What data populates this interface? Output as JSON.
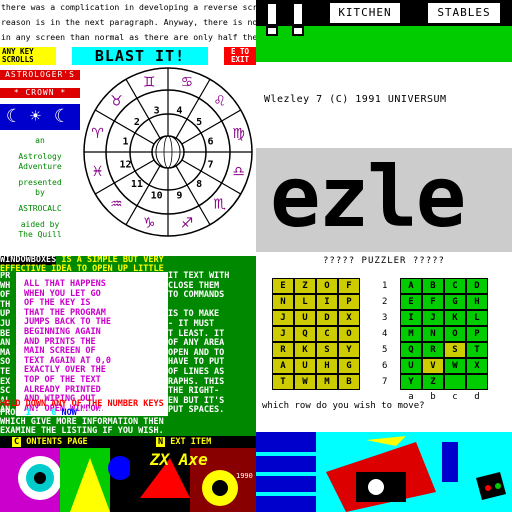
{
  "tl": {
    "scroll_lines": [
      "there was a complication  in  developing  a  reverse  scroll.The",
      "reason is in the next paragraph. Anyway, there is no  more  text",
      "in any screen than normal as there are only  half  the  vertical"
    ],
    "any_key": [
      "ANY KEY",
      "SCROLLS"
    ],
    "blast": "BLAST IT!",
    "exit": [
      "E TO",
      "EXIT"
    ],
    "astrologers": "ASTROLOGER'S",
    "crown": "* CROWN *",
    "moon_icons": [
      "☾",
      "☀",
      "☾"
    ],
    "side_lines": [
      "an",
      "Astrology",
      "Adventure",
      "presented",
      "by",
      "ASTROCALC",
      "aided  by",
      "The Quill"
    ],
    "wheel_numbers": [
      "1",
      "2",
      "3",
      "4",
      "5",
      "6",
      "7",
      "8",
      "9",
      "10",
      "11",
      "12"
    ],
    "wheel_signs": [
      "♈",
      "♉",
      "♊",
      "♋",
      "♌",
      "♍",
      "♎",
      "♏",
      "♐",
      "♑",
      "♒",
      "♓"
    ],
    "colors": {
      "wheel_line": "#000000",
      "sign_color": "#880088"
    }
  },
  "tr": {
    "kitchen": "KITCHEN",
    "stables": "STABLES",
    "title_line": "Wlezley 7    (C)  1991  UNIVERSUM",
    "logo": "ezle"
  },
  "bl": {
    "lines": [
      {
        "segs": [
          {
            "t": "WINDOWBOXES",
            "c": "hl-blk"
          },
          {
            "t": " IS A SIMPLE BUT VERY"
          }
        ]
      },
      {
        "segs": [
          {
            "t": "EFFECTIVE IDEA TO OPEN UP LITTLE"
          }
        ]
      }
    ],
    "popup_lines": [
      "ALL THAT HAPPENS",
      "WHEN YOU LET GO",
      "OF THE KEY IS",
      "THAT THE PROGRAM",
      "JUMPS BACK TO THE",
      "BEGINNING AGAIN",
      "AND PRINTS THE",
      "MAIN SCREEN OF",
      "TEXT AGAIN AT 0,0",
      "EXACTLY OVER THE",
      "TOP OF THE TEXT",
      "ALREADY PRINTED",
      "AND WIPING OUT",
      "ANY OPEN WINDOW."
    ],
    "under_lines": [
      "IT TEXT WITH",
      " CLOSE THEM",
      "TO COMMANDS",
      "",
      " IS TO MAKE",
      " - IT MUST",
      "T LEAST. IT",
      " OF ANY AREA",
      " OPEN AND TO",
      "HAVE TO PUT",
      " OF LINES AS",
      "RAPHS. THIS",
      "  THE RIGHT-",
      "EN BUT IT'S",
      "PUT SPACES."
    ],
    "left_lines": [
      "PR",
      "WH",
      "OF",
      "TH",
      "UP",
      "JU",
      "BE",
      "AN",
      "MA",
      "SO",
      "TE",
      "EX",
      "SC",
      "AL",
      "AN"
    ],
    "hold_line": [
      {
        "t": "HOLD DOWN ANY OF THE NUMBER KEYS",
        "c": "hl-red"
      }
    ],
    "from_line": [
      {
        "t": "FROM "
      },
      {
        "t": "1",
        "c": "hl-cyan"
      },
      {
        "t": " TO "
      },
      {
        "t": "6",
        "c": "hl-cyan"
      },
      {
        "t": " NOW",
        "c": "hl-blue"
      },
      {
        "t": " TO OPEN  WINDOWS"
      }
    ],
    "which_line": "WHICH GIVE MORE INFORMATION THEN",
    "examine_line": "EXAMINE THE LISTING IF YOU WISH.",
    "footer": [
      {
        "key": "C",
        "label": "ONTENTS PAGE"
      },
      {
        "key": "N",
        "label": "EXT ITEM"
      }
    ],
    "art_year": "1990",
    "art_label": "ZX Axe"
  },
  "br": {
    "title": "????? PUZZLER ?????",
    "left_grid": [
      [
        "E",
        "Z",
        "O",
        "F"
      ],
      [
        "N",
        "L",
        "I",
        "P"
      ],
      [
        "J",
        "U",
        "D",
        "X"
      ],
      [
        "J",
        "Q",
        "C",
        "O"
      ],
      [
        "R",
        "K",
        "S",
        "Y"
      ],
      [
        "A",
        "U",
        "H",
        "G"
      ],
      [
        "T",
        "W",
        "M",
        "B"
      ]
    ],
    "right_grid": [
      [
        "A",
        "B",
        "C",
        "D"
      ],
      [
        "E",
        "F",
        "G",
        "H"
      ],
      [
        "I",
        "J",
        "K",
        "L"
      ],
      [
        "M",
        "N",
        "O",
        "P"
      ],
      [
        "Q",
        "R",
        "S",
        "T"
      ],
      [
        "U",
        "V",
        "W",
        "X"
      ],
      [
        "Y",
        "Z",
        "",
        ""
      ]
    ],
    "row_numbers": [
      "1",
      "2",
      "3",
      "4",
      "5",
      "6",
      "7"
    ],
    "col_labels": [
      "a",
      "b",
      "c",
      "d"
    ],
    "question": "which row do you wish to move?",
    "colors": {
      "cell_yellow": "#cccc00",
      "cell_green": "#00cc00",
      "cell_highlight": "#cccc00"
    }
  }
}
